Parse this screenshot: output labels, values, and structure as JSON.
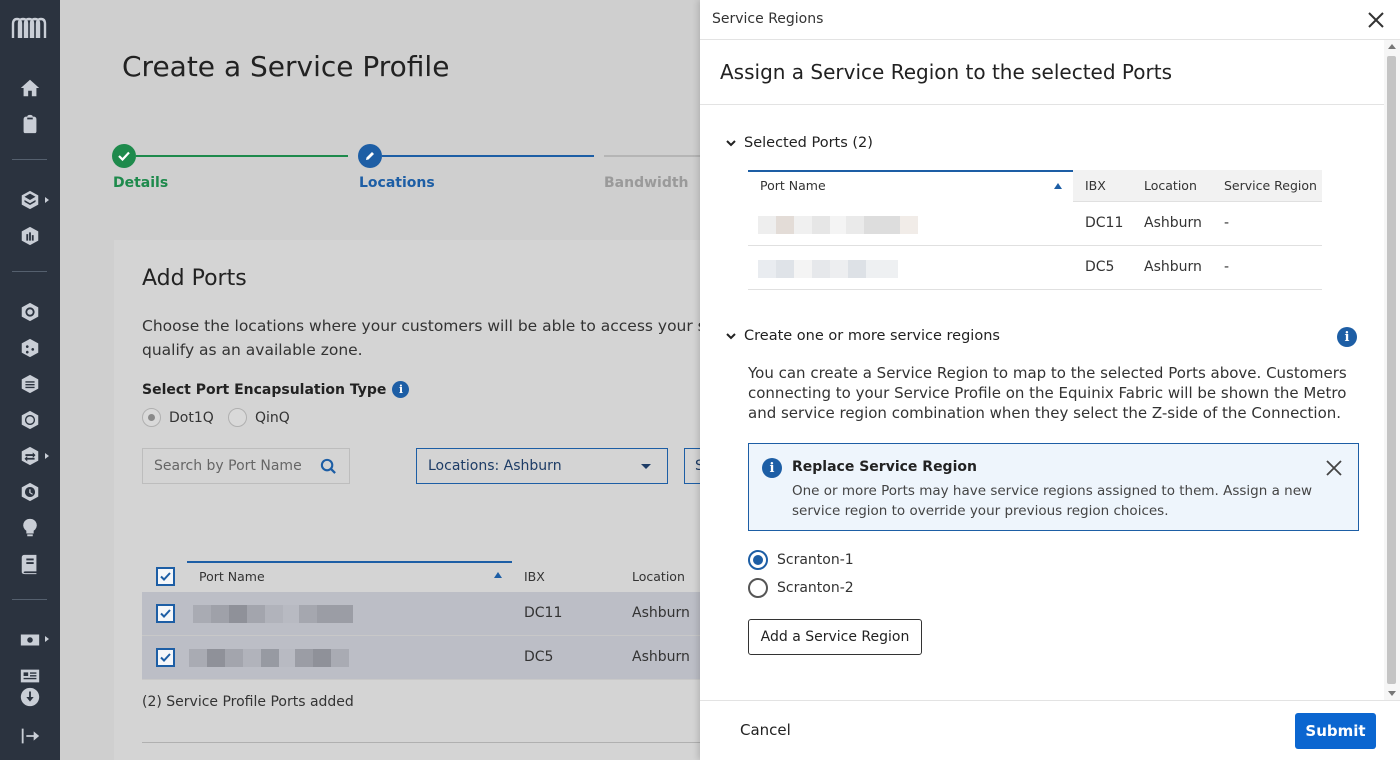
{
  "page": {
    "title": "Create a Service Profile",
    "steps": [
      {
        "label": "Details",
        "state": "complete"
      },
      {
        "label": "Locations",
        "state": "active"
      },
      {
        "label": "Bandwidth",
        "state": "pending"
      }
    ],
    "add_ports": {
      "heading": "Add Ports",
      "description_line1": "Choose the locations where your customers will be able to access your serv",
      "description_line2": "qualify as an available zone.",
      "encapsulation_label": "Select Port Encapsulation Type",
      "encapsulation_options": [
        "Dot1Q",
        "QinQ"
      ],
      "encapsulation_selected": "Dot1Q",
      "search_placeholder": "Search by Port Name",
      "locations_filter": "Locations: Ashburn",
      "third_filter_initial": "S",
      "table": {
        "columns": [
          "Port Name",
          "IBX",
          "Location"
        ],
        "rows": [
          {
            "ibx": "DC11",
            "location": "Ashburn",
            "checked": true
          },
          {
            "ibx": "DC5",
            "location": "Ashburn",
            "checked": true
          }
        ]
      },
      "footnote": "(2) Service Profile Ports added"
    }
  },
  "drawer": {
    "title": "Service Regions",
    "subtitle": "Assign a Service Region to the selected Ports",
    "selected_ports": {
      "heading": "Selected Ports (2)",
      "columns": [
        "Port Name",
        "IBX",
        "Location",
        "Service Region"
      ],
      "rows": [
        {
          "ibx": "DC11",
          "location": "Ashburn",
          "service_region": "-"
        },
        {
          "ibx": "DC5",
          "location": "Ashburn",
          "service_region": "-"
        }
      ]
    },
    "create_regions": {
      "heading": "Create one or more service regions",
      "paragraph_line1": "You can create a Service Region to map to the selected Ports above. Customers",
      "paragraph_line2": "connecting to your Service Profile on the Equinix Fabric will be shown the Metro",
      "paragraph_line3": "and service region combination when they select the Z-side of the Connection.",
      "notice_title": "Replace Service Region",
      "notice_line1": "One or more Ports may have service regions assigned to them. Assign a new",
      "notice_line2": "service region to override your previous region choices.",
      "regions": [
        "Scranton-1",
        "Scranton-2"
      ],
      "selected_region": "Scranton-1",
      "add_button": "Add a Service Region"
    },
    "cancel_label": "Cancel",
    "submit_label": "Submit"
  },
  "colors": {
    "rail": "#2b333f",
    "accent": "#1d5ea5",
    "submit": "#0b66d0",
    "complete": "#1e8a4c"
  },
  "icons": {
    "rail": [
      "equinix-logo-icon",
      "home-icon",
      "clipboard-icon",
      "layers-icon",
      "chart-icon",
      "network-icon",
      "nodes-icon",
      "stack-icon",
      "globe-icon",
      "exchange-icon",
      "clock-icon",
      "lightbulb-icon",
      "book-icon",
      "billing-icon",
      "contact-card-icon",
      "download-icon",
      "logout-icon"
    ]
  }
}
